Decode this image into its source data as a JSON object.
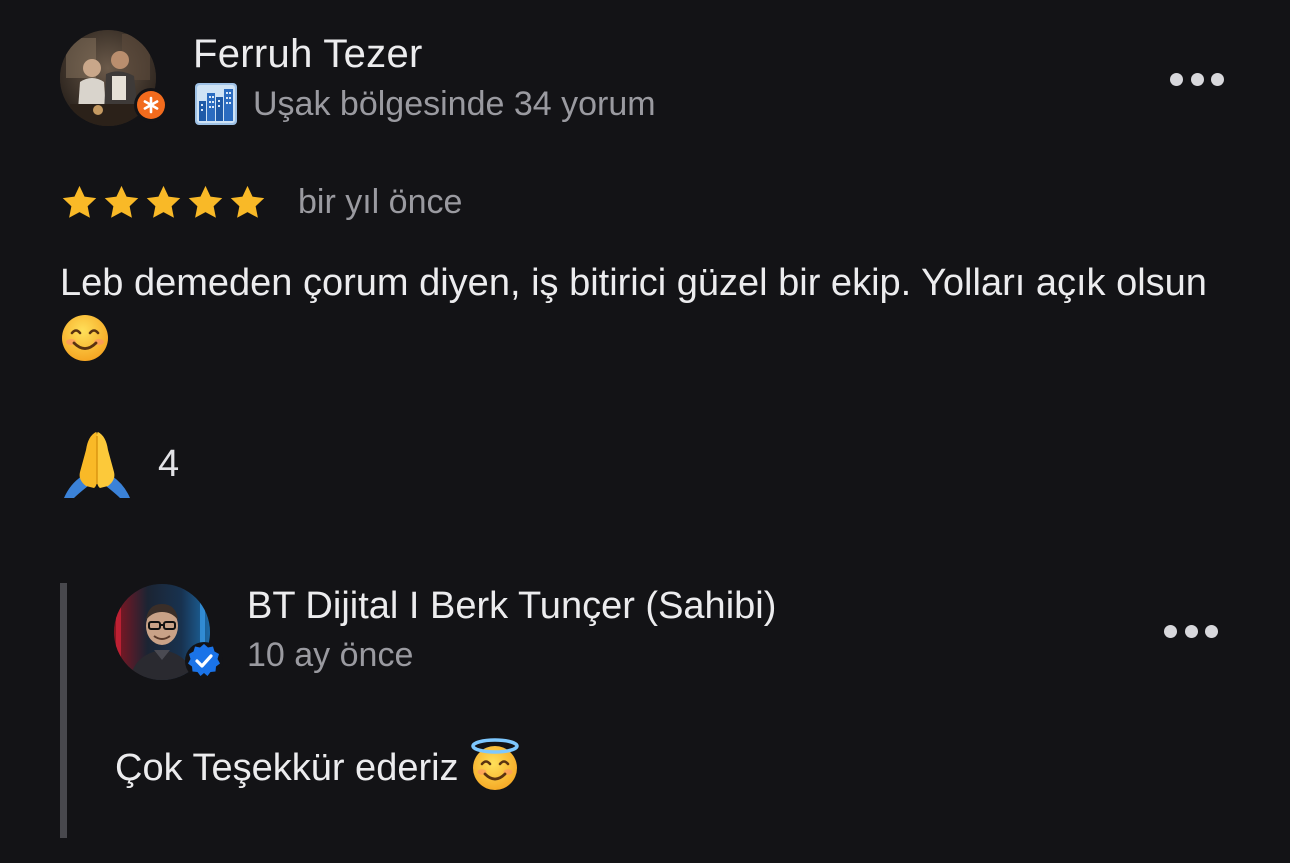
{
  "review": {
    "reviewer_name": "Ferruh Tezer",
    "reviewer_meta": "Uşak bölgesinde 34 yorum",
    "rating": 5,
    "rating_max": 5,
    "date": "bir yıl önce",
    "text": "Leb demeden çorum diyen, iş bitirici güzel bir ekip. Yolları açık olsun",
    "badge_icon": "local-guide-icon",
    "meta_icon": "cityscape-icon"
  },
  "reaction": {
    "icon": "folded-hands-icon",
    "count": "4"
  },
  "reply": {
    "owner_name": "BT Dijital I Berk Tunçer (Sahibi)",
    "date": "10 ay önce",
    "text": "Çok Teşekkür ederiz",
    "badge_icon": "verified-check-icon"
  },
  "colors": {
    "background": "#131316",
    "star": "#f9b927",
    "local_guide_badge": "#f26b1d",
    "verified_badge": "#1a73e8",
    "muted_text": "#9a9aa0"
  }
}
